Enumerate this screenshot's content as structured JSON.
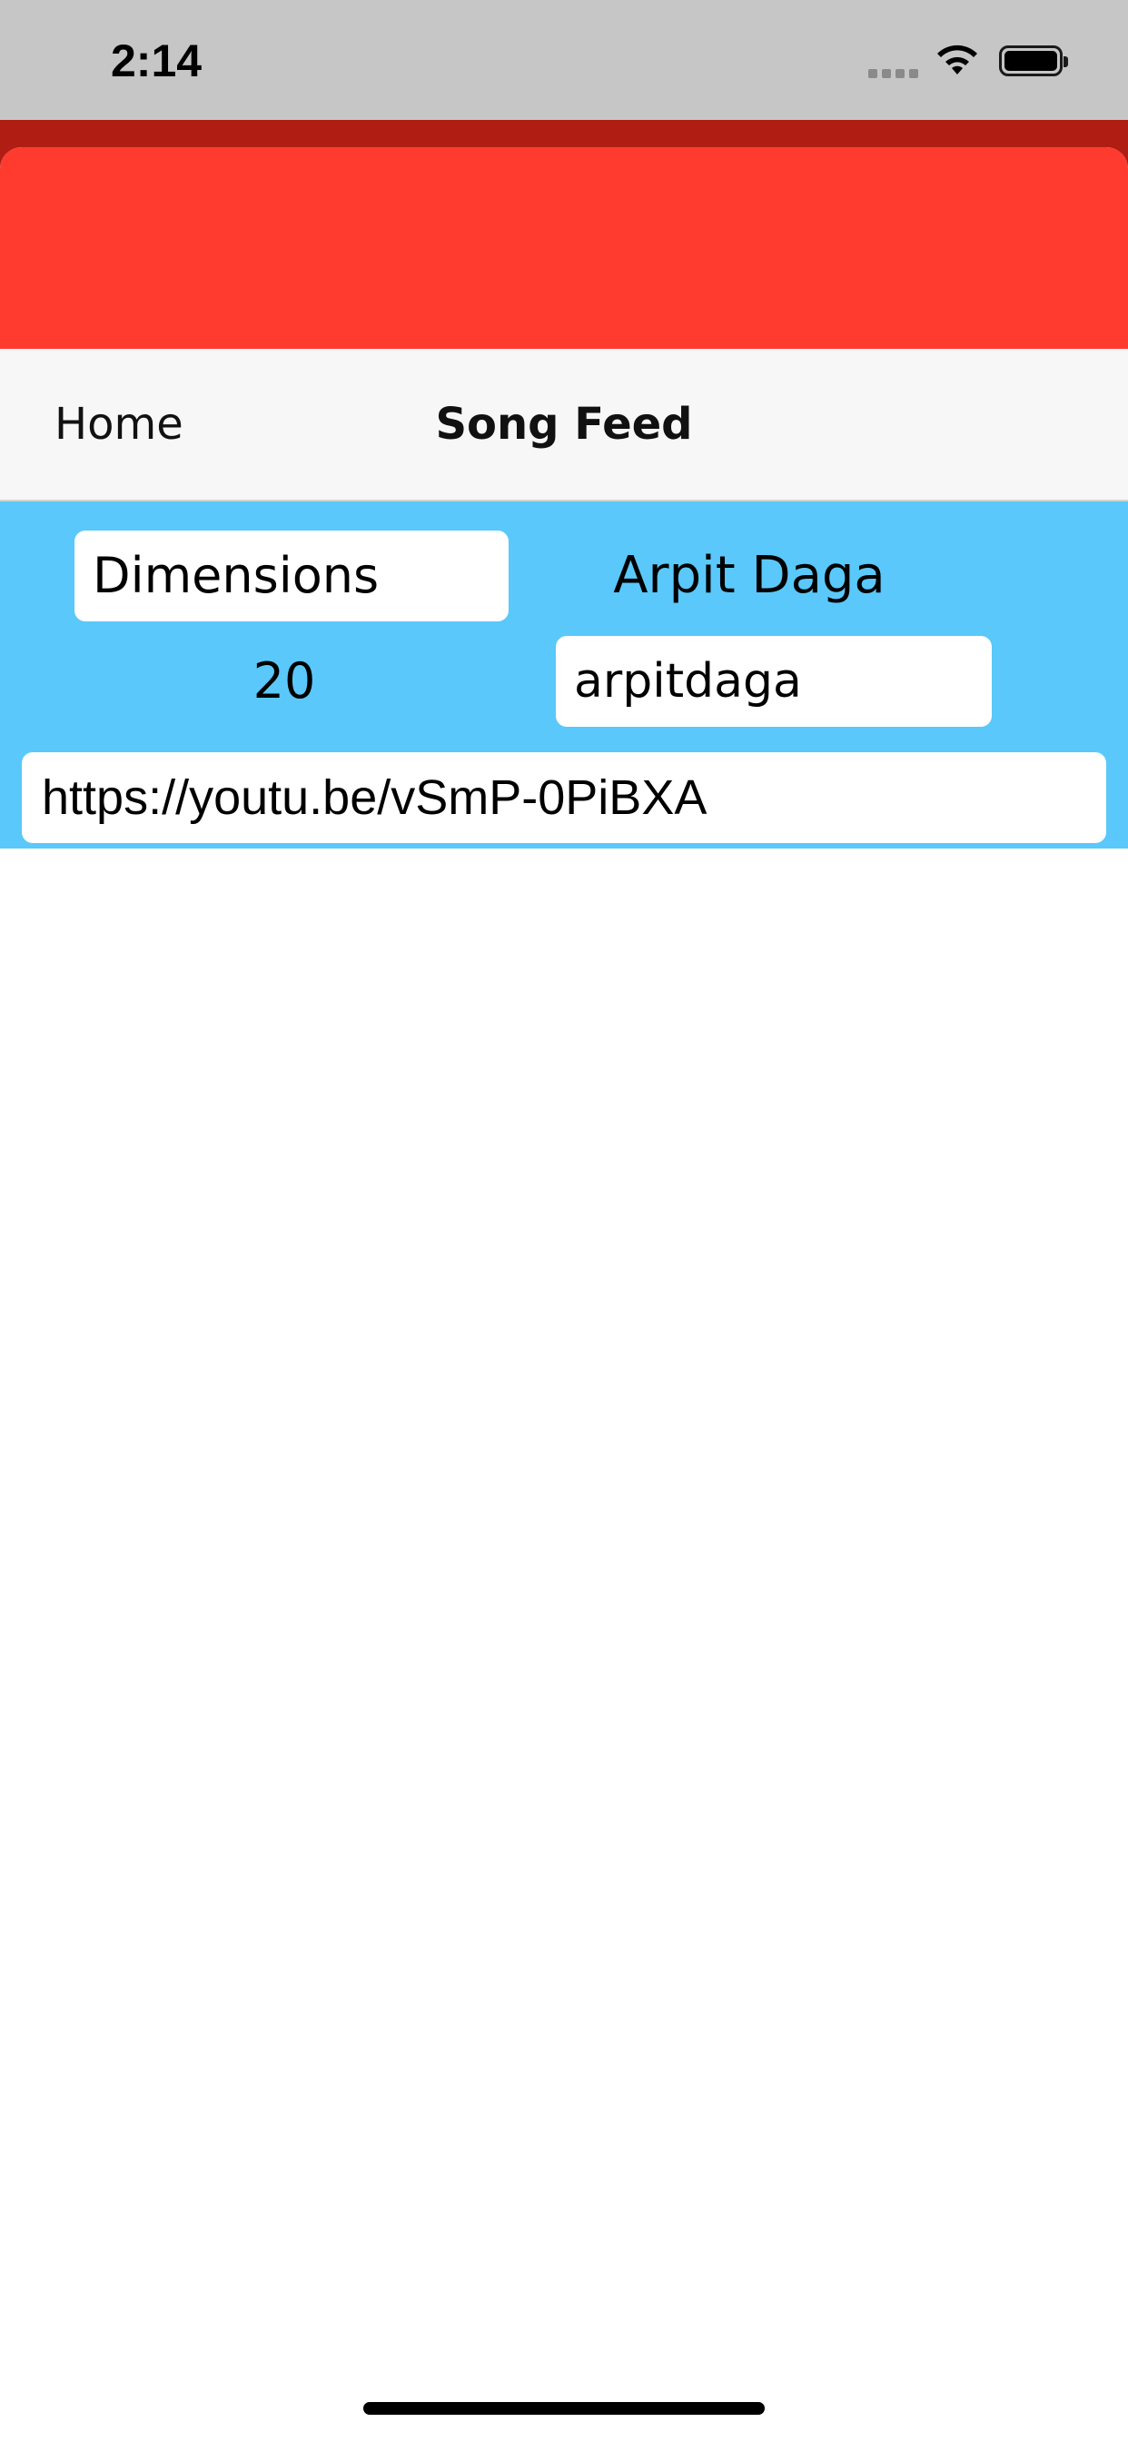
{
  "status_bar": {
    "time": "2:14",
    "icons": [
      "cellular-signal-icon",
      "wifi-icon",
      "battery-icon"
    ]
  },
  "colors": {
    "status_bar_bg": "#c6c6c6",
    "backdrop": "#b01e13",
    "header_red": "#ff3b30",
    "nav_bg": "#f7f7f7",
    "card_blue": "#5ac8fa"
  },
  "nav": {
    "back_label": "Home",
    "title": "Song Feed"
  },
  "song": {
    "name": "Dimensions",
    "artist": "Arpit Daga",
    "rating": "20",
    "username": "arpitdaga",
    "link": "https://youtu.be/vSmP-0PiBXA"
  }
}
